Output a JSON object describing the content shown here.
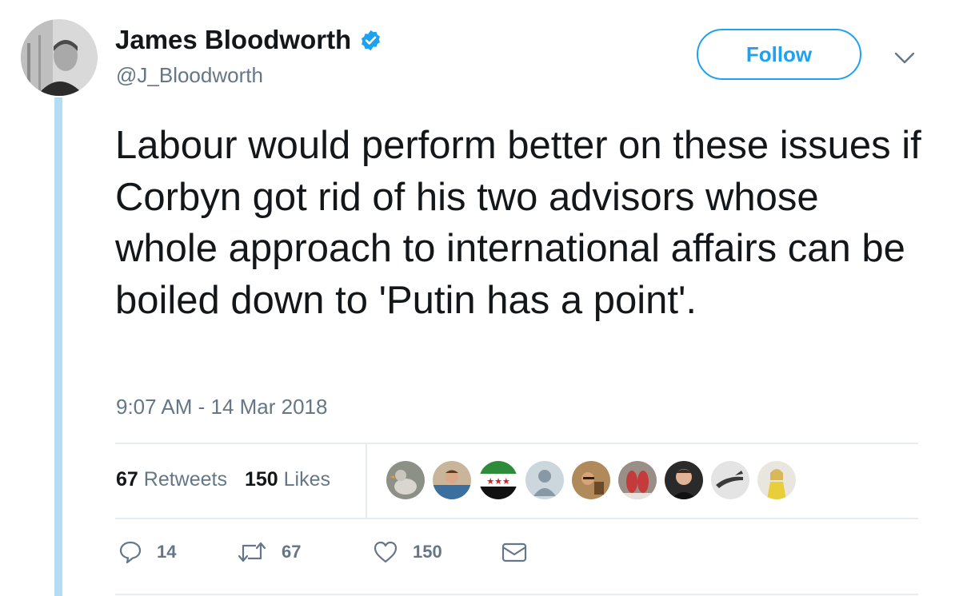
{
  "tweet": {
    "author_name": "James Bloodworth",
    "author_handle": "@J_Bloodworth",
    "follow_label": "Follow",
    "text": "Labour would perform better on these issues if Corbyn got rid of his two advisors whose whole approach to international affairs can be boiled down to 'Putin has a point'.",
    "timestamp": "9:07 AM - 14 Mar 2018"
  },
  "stats": {
    "retweets_count": "67",
    "retweets_label": "Retweets",
    "likes_count": "150",
    "likes_label": "Likes"
  },
  "actions": {
    "reply_count": "14",
    "retweet_count": "67",
    "like_count": "150"
  },
  "icons": [
    "verified-badge-icon",
    "chevron-down-icon",
    "reply-icon",
    "retweet-icon",
    "like-heart-icon",
    "direct-message-icon"
  ],
  "colors": {
    "accent": "#1da1f2",
    "secondary_text": "#657786",
    "thread_line": "#b3dcf5"
  }
}
